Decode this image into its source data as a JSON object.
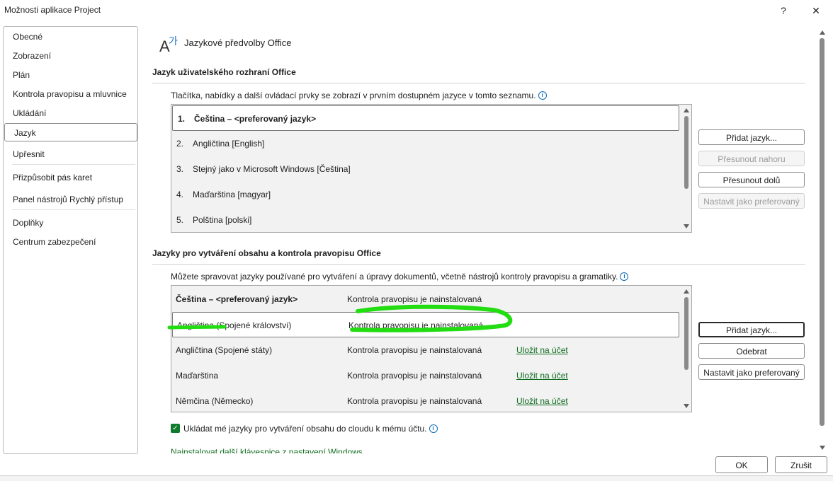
{
  "window": {
    "title": "Možnosti aplikace Project",
    "help_label": "?",
    "close_label": "✕"
  },
  "nav": {
    "items": [
      "Obecné",
      "Zobrazení",
      "Plán",
      "Kontrola pravopisu a mluvnice",
      "Ukládání",
      "Jazyk",
      "Upřesnit",
      "Přizpůsobit pás karet",
      "Panel nástrojů Rychlý přístup",
      "Doplňky",
      "Centrum zabezpečení"
    ],
    "selected": "Jazyk"
  },
  "page": {
    "title": "Jazykové předvolby Office"
  },
  "ui_language": {
    "heading": "Jazyk uživatelského rozhraní Office",
    "description": "Tlačítka, nabídky a další ovládací prvky se zobrazí v prvním dostupném jazyce v tomto seznamu.",
    "rows": [
      {
        "num": "1.",
        "label": "Čeština – <preferovaný jazyk>"
      },
      {
        "num": "2.",
        "label": "Angličtina [English]"
      },
      {
        "num": "3.",
        "label": "Stejný jako v Microsoft Windows [Čeština]"
      },
      {
        "num": "4.",
        "label": "Maďarština [magyar]"
      },
      {
        "num": "5.",
        "label": "Polština [polski]"
      }
    ],
    "buttons": {
      "add": "Přidat jazyk...",
      "move_up": "Přesunout nahoru",
      "move_down": "Přesunout dolů",
      "set_preferred": "Nastavit jako preferovaný"
    }
  },
  "authoring": {
    "heading": "Jazyky pro vytváření obsahu a kontrola pravopisu Office",
    "description": "Můžete spravovat jazyky používané pro vytváření a úpravy dokumentů, včetně nástrojů kontroly pravopisu a gramatiky.",
    "rows": [
      {
        "lang": "Čeština – <preferovaný jazyk>",
        "status": "Kontrola pravopisu je nainstalovaná",
        "action": ""
      },
      {
        "lang": "Angličtina (Spojené království)",
        "status": "Kontrola pravopisu je nainstalovaná",
        "action": ""
      },
      {
        "lang": "Angličtina (Spojené státy)",
        "status": "Kontrola pravopisu je nainstalovaná",
        "action": "Uložit na účet"
      },
      {
        "lang": "Maďarština",
        "status": "Kontrola pravopisu je nainstalovaná",
        "action": "Uložit na účet"
      },
      {
        "lang": "Němčina (Německo)",
        "status": "Kontrola pravopisu je nainstalovaná",
        "action": "Uložit na účet"
      }
    ],
    "buttons": {
      "add": "Přidat jazyk...",
      "remove": "Odebrat",
      "set_preferred": "Nastavit jako preferovaný"
    },
    "cloud_checkbox_label": "Ukládat mé jazyky pro vytváření obsahu do cloudu k mému účtu.",
    "cloud_checked": true,
    "keyboard_link": "Nainstalovat další klávesnice z nastavení Windows"
  },
  "footer": {
    "ok": "OK",
    "cancel": "Zrušit"
  },
  "colors": {
    "accent_green": "#0f7b2c",
    "annotation_green": "#22dd11"
  },
  "icons": {
    "language": "language-icon",
    "info": "info-icon"
  }
}
